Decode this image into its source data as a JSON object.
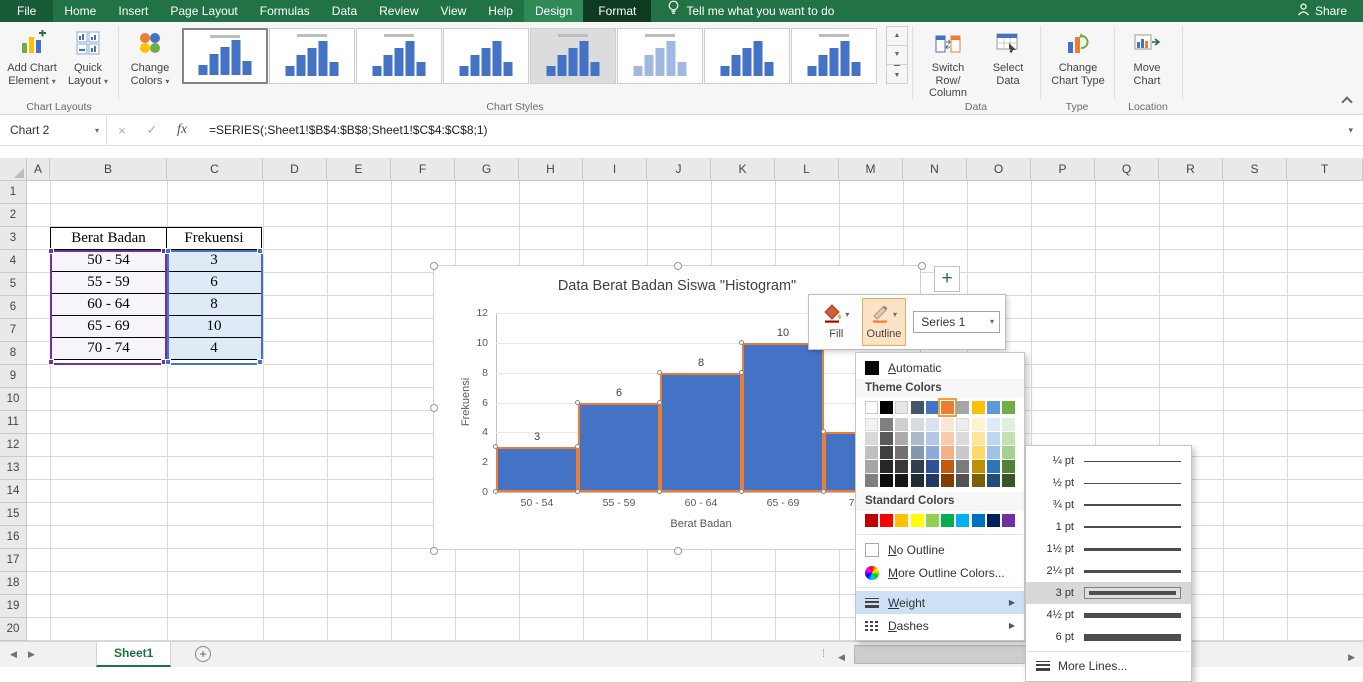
{
  "icons": {
    "dropdown": "▾",
    "cancel": "×",
    "check": "✓",
    "submenu": "▶",
    "up": "▲",
    "down": "▼",
    "left": "◀",
    "right": "▶",
    "plus": "+"
  },
  "titlebar": {
    "file_tab": "File",
    "tabs": [
      "Home",
      "Insert",
      "Page Layout",
      "Formulas",
      "Data",
      "Review",
      "View",
      "Help"
    ],
    "design_tab": "Design",
    "format_tab": "Format",
    "tell_me": "Tell me what you want to do",
    "share_label": "Share"
  },
  "ribbon": {
    "add_chart_element": [
      "Add Chart",
      "Element"
    ],
    "quick_layout": [
      "Quick",
      "Layout"
    ],
    "change_colors": [
      "Change",
      "Colors"
    ],
    "switch_row_column": [
      "Switch Row/",
      "Column"
    ],
    "select_data": [
      "Select",
      "Data"
    ],
    "change_chart_type": [
      "Change",
      "Chart Type"
    ],
    "move_chart": [
      "Move",
      "Chart"
    ],
    "group_labels": [
      "Chart Layouts",
      "Chart Styles",
      "Data",
      "Type",
      "Location"
    ],
    "style_gallery": [
      {
        "name": "Style 1",
        "variant": "selected"
      },
      {
        "name": "Style 2",
        "variant": "titled"
      },
      {
        "name": "Style 3",
        "variant": "titled"
      },
      {
        "name": "Style 4",
        "variant": "plain"
      },
      {
        "name": "Style 5",
        "variant": "hover"
      },
      {
        "name": "Style 6",
        "variant": "light"
      },
      {
        "name": "Style 7",
        "variant": "plain"
      },
      {
        "name": "Style 8",
        "variant": "titled"
      }
    ]
  },
  "formula_bar": {
    "name_box": "Chart 2",
    "fx": "fx",
    "formula": "=SERIES(;Sheet1!$B$4:$B$8;Sheet1!$C$4:$C$8;1)"
  },
  "grid": {
    "columns": [
      "A",
      "B",
      "C",
      "D",
      "E",
      "F",
      "G",
      "H",
      "I",
      "J",
      "K",
      "L",
      "M",
      "N",
      "O",
      "P",
      "Q",
      "R",
      "S",
      "T"
    ],
    "rows": [
      "1",
      "2",
      "3",
      "4",
      "5",
      "6",
      "7",
      "8",
      "9",
      "10",
      "11",
      "12",
      "13",
      "14",
      "15",
      "16",
      "17",
      "18",
      "19",
      "20"
    ],
    "table": {
      "col1_header": "Berat Badan",
      "col2_header": "Frekuensi",
      "rows": [
        [
          "50 - 54",
          "3"
        ],
        [
          "55 - 59",
          "6"
        ],
        [
          "60 - 64",
          "8"
        ],
        [
          "65 - 69",
          "10"
        ],
        [
          "70 - 74",
          "4"
        ]
      ]
    }
  },
  "chart_data": {
    "type": "bar",
    "title": "Data Berat Badan Siswa \"Histogram\"",
    "categories": [
      "50 - 54",
      "55 - 59",
      "60 - 64",
      "65 - 69",
      "70 - 74"
    ],
    "values": [
      3,
      6,
      8,
      10,
      4
    ],
    "xlabel": "Berat Badan",
    "ylabel": "Frekuensi",
    "ylim": [
      0,
      12
    ],
    "ytick_step": 2,
    "grid": true,
    "legend": false,
    "data_labels": true,
    "bar_fill": "#4472C4",
    "bar_outline": "#ED7D31",
    "selected_series": "Series 1"
  },
  "mini_toolbar": {
    "fill": "Fill",
    "outline": "Outline",
    "series": "Series 1"
  },
  "outline_menu": {
    "automatic": "Automatic",
    "theme_colors_label": "Theme Colors",
    "standard_colors_label": "Standard Colors",
    "no_outline": "No Outline",
    "more_outline_colors": "More Outline Colors...",
    "weight_label": "Weight",
    "dashes_label": "Dashes",
    "selected_color": "#ED7D31",
    "theme_colors": [
      "#FFFFFF",
      "#000000",
      "#E7E6E6",
      "#44546A",
      "#4472C4",
      "#ED7D31",
      "#A5A5A5",
      "#FFC000",
      "#5B9BD5",
      "#70AD47"
    ],
    "theme_variants": [
      [
        "#F2F2F2",
        "#D9D9D9",
        "#BFBFBF",
        "#A6A6A6",
        "#7F7F7F"
      ],
      [
        "#7F7F7F",
        "#595959",
        "#404040",
        "#262626",
        "#0D0D0D"
      ],
      [
        "#D0CECE",
        "#AEAAAA",
        "#757171",
        "#3A3838",
        "#171717"
      ],
      [
        "#D6DCE4",
        "#ACB9CA",
        "#8496B0",
        "#333F4F",
        "#222B35"
      ],
      [
        "#D9E2F3",
        "#B4C6E7",
        "#8EAADB",
        "#2F5496",
        "#1F3864"
      ],
      [
        "#FBE5D5",
        "#F7CBAC",
        "#F4B183",
        "#C55A11",
        "#833C00"
      ],
      [
        "#EDEDED",
        "#DBDBDB",
        "#C9C9C9",
        "#7B7B7B",
        "#525252"
      ],
      [
        "#FFF2CC",
        "#FFE599",
        "#FFD966",
        "#BF9000",
        "#7F6000"
      ],
      [
        "#DEEBF6",
        "#BDD7EE",
        "#9DC3E6",
        "#2E75B5",
        "#1F4E79"
      ],
      [
        "#E2EFD9",
        "#C5E0B3",
        "#A8D08D",
        "#538135",
        "#375623"
      ]
    ],
    "standard_colors": [
      "#C00000",
      "#FF0000",
      "#FFC000",
      "#FFFF00",
      "#92D050",
      "#00B050",
      "#00B0F0",
      "#0070C0",
      "#002060",
      "#7030A0"
    ]
  },
  "weight_menu": {
    "items": [
      {
        "label": "¼ pt",
        "thickness": 1,
        "selected": false
      },
      {
        "label": "½ pt",
        "thickness": 1,
        "selected": false
      },
      {
        "label": "¾ pt",
        "thickness": 2,
        "selected": false
      },
      {
        "label": "1 pt",
        "thickness": 2,
        "selected": false
      },
      {
        "label": "1½ pt",
        "thickness": 3,
        "selected": false
      },
      {
        "label": "2¼ pt",
        "thickness": 3,
        "selected": false
      },
      {
        "label": "3 pt",
        "thickness": 4,
        "selected": true
      },
      {
        "label": "4½ pt",
        "thickness": 5,
        "selected": false
      },
      {
        "label": "6 pt",
        "thickness": 7,
        "selected": false
      }
    ],
    "more_lines": "More Lines..."
  },
  "sheet_bar": {
    "active_sheet": "Sheet1"
  }
}
